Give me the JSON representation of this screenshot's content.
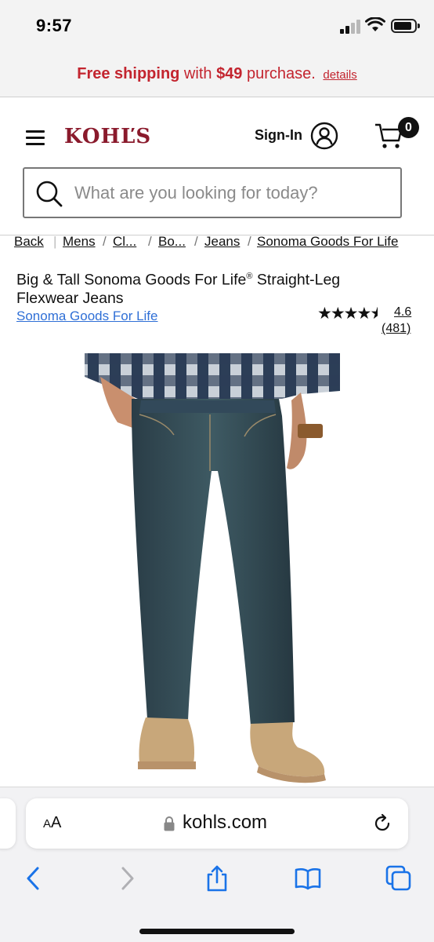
{
  "status_bar": {
    "time": "9:57",
    "icons": [
      "cellular-signal-icon",
      "wifi-icon",
      "battery-icon"
    ]
  },
  "promo": {
    "part1": "Free shipping",
    "part2": " with ",
    "part3": "$49",
    "part4": " purchase.",
    "details": "details",
    "color": "#c3252f"
  },
  "header": {
    "logo": "KOHĽS",
    "sign_in": "Sign-In",
    "cart_count": "0",
    "brand_color": "#8a1a2c"
  },
  "search": {
    "placeholder": "What are you looking for today?"
  },
  "breadcrumb": {
    "items": [
      "Back",
      "Mens",
      "Cl...",
      "Bo...",
      "Jeans",
      "Sonoma Goods For Life"
    ]
  },
  "product": {
    "title_line1": "Big & Tall Sonoma Goods For Life",
    "title_reg": "®",
    "title_line1_end": " Straight-Leg",
    "title_line2": "Flexwear Jeans",
    "brand": "Sonoma Goods For Life",
    "rating": "4.6",
    "review_count": "(481)",
    "rating_value": 4.6,
    "rating_max": 5,
    "link_color": "#2f6fd6"
  },
  "browser": {
    "text_size_label": "AA",
    "url": "kohls.com",
    "toolbar_icons": [
      "back-icon",
      "forward-icon",
      "share-icon",
      "bookmarks-icon",
      "tabs-icon"
    ],
    "accent_color": "#1a73e8"
  }
}
